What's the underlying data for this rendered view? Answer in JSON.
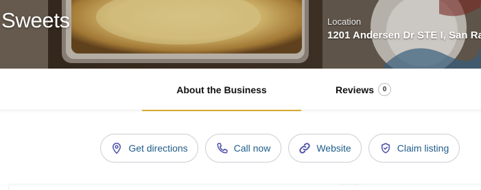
{
  "header": {
    "business_name": "Sweets",
    "location_label": "Location",
    "location_value": "1201 Andersen Dr STE I, San Ra"
  },
  "tabs": [
    {
      "label": "About the Business",
      "active": true
    },
    {
      "label": "Reviews",
      "count": "0",
      "active": false
    }
  ],
  "actions": [
    {
      "label": "Get directions",
      "icon": "location-pin-icon"
    },
    {
      "label": "Call now",
      "icon": "phone-icon"
    },
    {
      "label": "Website",
      "icon": "link-icon"
    },
    {
      "label": "Claim listing",
      "icon": "shield-check-icon"
    }
  ],
  "colors": {
    "accent": "#d6a92e",
    "button_text": "#1f5c8a",
    "icon": "#4a4fa8"
  }
}
